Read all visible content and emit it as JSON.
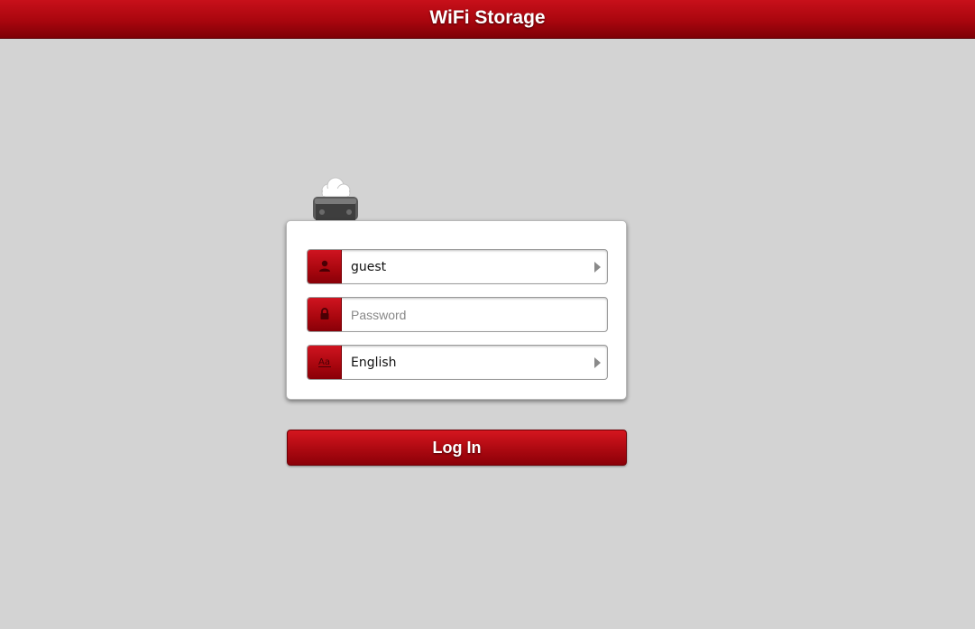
{
  "header": {
    "title": "WiFi Storage"
  },
  "device_icon": "wifi-storage-device-icon",
  "login": {
    "username": {
      "value": "guest",
      "icon": "user-icon"
    },
    "password": {
      "value": "",
      "placeholder": "Password",
      "icon": "lock-icon"
    },
    "language": {
      "value": "English",
      "icon": "language-icon"
    },
    "submit_label": "Log In"
  },
  "colors": {
    "accent": "#b00a12",
    "background": "#d3d3d3",
    "panel": "#ffffff"
  }
}
